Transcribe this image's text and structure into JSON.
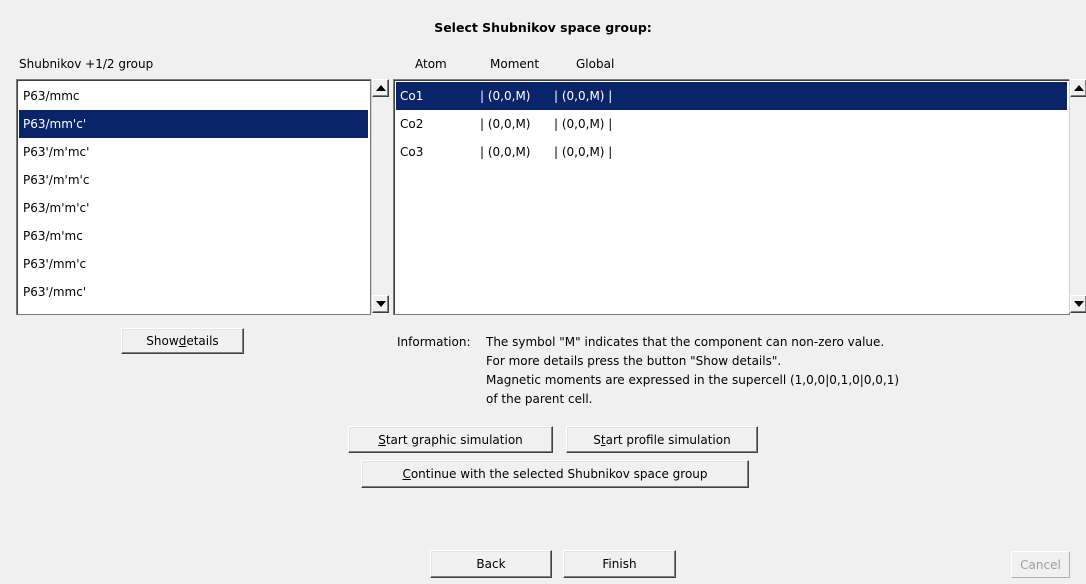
{
  "dialog": {
    "title": "Select Shubnikov space group:"
  },
  "left_panel": {
    "header": "Shubnikov +1/2 group",
    "items": [
      "P63/mmc",
      "P63/mm'c'",
      "P63'/m'mc'",
      "P63'/m'm'c",
      "P63/m'm'c'",
      "P63/m'mc",
      "P63'/mm'c",
      "P63'/mmc'"
    ],
    "selected_index": 1,
    "show_details": {
      "before": "Show ",
      "mnemonic": "d",
      "after": "etails"
    }
  },
  "right_panel": {
    "headers": {
      "atom": "Atom",
      "moment": "Moment",
      "global": "Global"
    },
    "rows": [
      {
        "atom": "Co1",
        "moment": "| (0,0,M)",
        "global": "| (0,0,M)  |"
      },
      {
        "atom": "Co2",
        "moment": "| (0,0,M)",
        "global": "| (0,0,M)  |"
      },
      {
        "atom": "Co3",
        "moment": "| (0,0,M)",
        "global": "| (0,0,M)  |"
      }
    ],
    "selected_index": 0
  },
  "information": {
    "prefix": "Information:",
    "lines": [
      "The symbol \"M\" indicates that the component can  non-zero value.",
      "For more details press the button \"Show details\".",
      "Magnetic moments are expressed in the supercell (1,0,0|0,1,0|0,0,1)",
      "of the parent cell."
    ]
  },
  "buttons": {
    "graphic_sim": {
      "mnemonic": "S",
      "after": "tart graphic simulation"
    },
    "profile_sim": {
      "before": "S",
      "mnemonic": "t",
      "after": "art profile simulation"
    },
    "continue": {
      "mnemonic": "C",
      "after": "ontinue with the selected Shubnikov space group"
    },
    "back": "Back",
    "finish": "Finish",
    "cancel": "Cancel"
  },
  "colors": {
    "selection": "#0a246a",
    "background": "#f0f0f0"
  }
}
